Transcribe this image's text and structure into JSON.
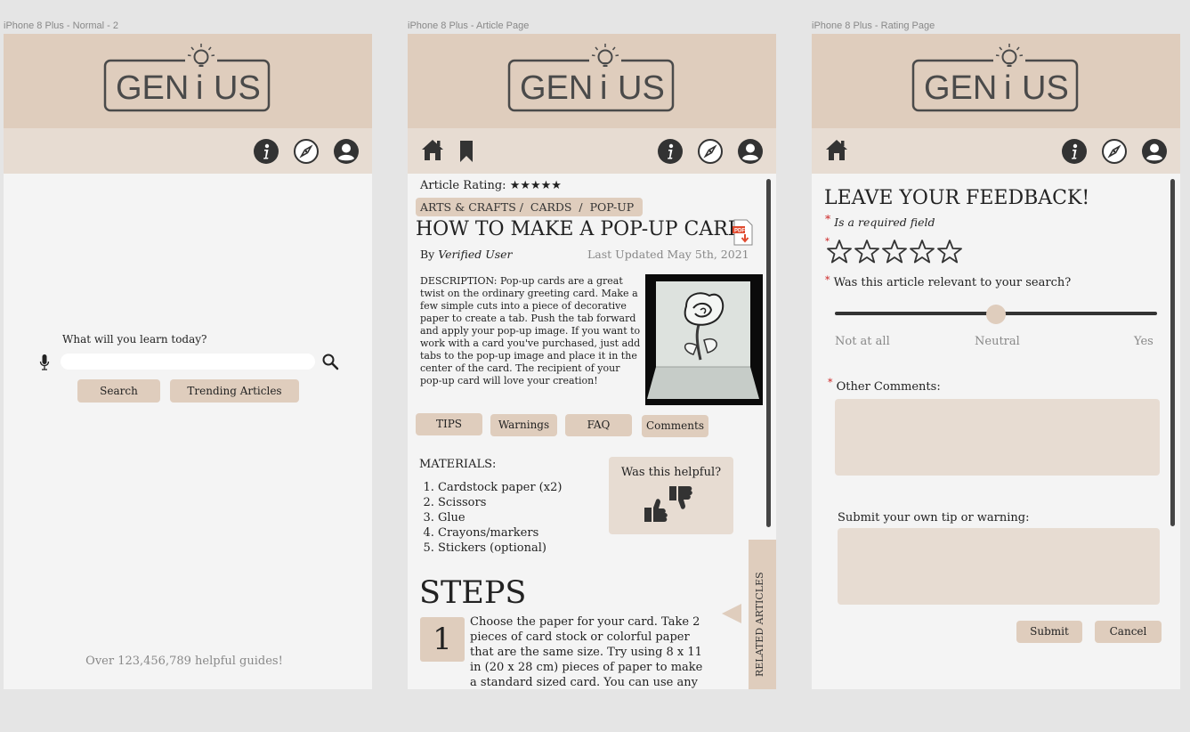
{
  "frames": [
    {
      "label": "iPhone 8 Plus - Normal - 2"
    },
    {
      "label": "iPhone 8 Plus - Article Page"
    },
    {
      "label": "iPhone 8 Plus - Rating Page"
    }
  ],
  "logo": {
    "left": "GEN",
    "mid": "i",
    "right": "US"
  },
  "colors": {
    "header": "#dfcdbd",
    "nav": "#e7dcd2",
    "button": "#dfcdbd",
    "required": "#cc2222",
    "icon": "#333333"
  },
  "icons": [
    "info-icon",
    "compass-icon",
    "profile-icon",
    "home-icon",
    "bookmark-icon",
    "microphone-icon",
    "search-icon",
    "pdf-download-icon",
    "thumbs-icon",
    "star-icon"
  ],
  "home": {
    "prompt": "What will you learn today?",
    "search_value": "",
    "search_button": "Search",
    "trending_button": "Trending Articles",
    "footer": "Over 123,456,789 helpful guides!"
  },
  "article": {
    "rating_label": "Article Rating:",
    "rating_stars": "★★★★★",
    "breadcrumb": "ARTS & CRAFTS /  CARDS  /  POP-UP",
    "title": "HOW TO MAKE A POP-UP CARD",
    "by_label": "By",
    "author": "Verified User",
    "updated": "Last Updated May 5th, 2021",
    "description": "DESCRIPTION: Pop-up cards are a great twist on the ordinary greeting card. Make a few simple cuts into a piece of decorative paper to create a tab. Push the tab forward and apply your pop-up image. If you want to work with a card you've purchased, just add tabs to the pop-up image and place it in the center of the card. The recipient of your pop-up card will love your creation!",
    "tabs": [
      "TIPS",
      "Warnings",
      "FAQ",
      "Comments"
    ],
    "materials_heading": "MATERIALS:",
    "materials": [
      "Cardstock paper (x2)",
      "Scissors",
      "Glue",
      "Crayons/markers",
      "Stickers (optional)"
    ],
    "helpful_label": "Was this helpful?",
    "steps_heading": "STEPS",
    "step_number": "1",
    "step_text": "Choose the paper for your card. Take 2 pieces of card stock or colorful paper that are the same size. Try using 8 x 11 in (20 x 28 cm) pieces of paper to make a standard sized card. You can use any heavy type of",
    "related_label": "RELATED ARTICLES"
  },
  "rating": {
    "heading": "LEAVE YOUR FEEDBACK!",
    "asterisk": "*",
    "required_note": "Is a required field",
    "stars": "☆☆☆☆☆",
    "stars_value": 0,
    "relevance_question": "Was this article relevant to your search?",
    "slider_value": 0.5,
    "slider_labels": [
      "Not at all",
      "Neutral",
      "Yes"
    ],
    "comments_label": "Other Comments:",
    "comments_value": "",
    "tip_label": "Submit your own tip or warning:",
    "tip_value": "",
    "submit_button": "Submit",
    "cancel_button": "Cancel"
  }
}
